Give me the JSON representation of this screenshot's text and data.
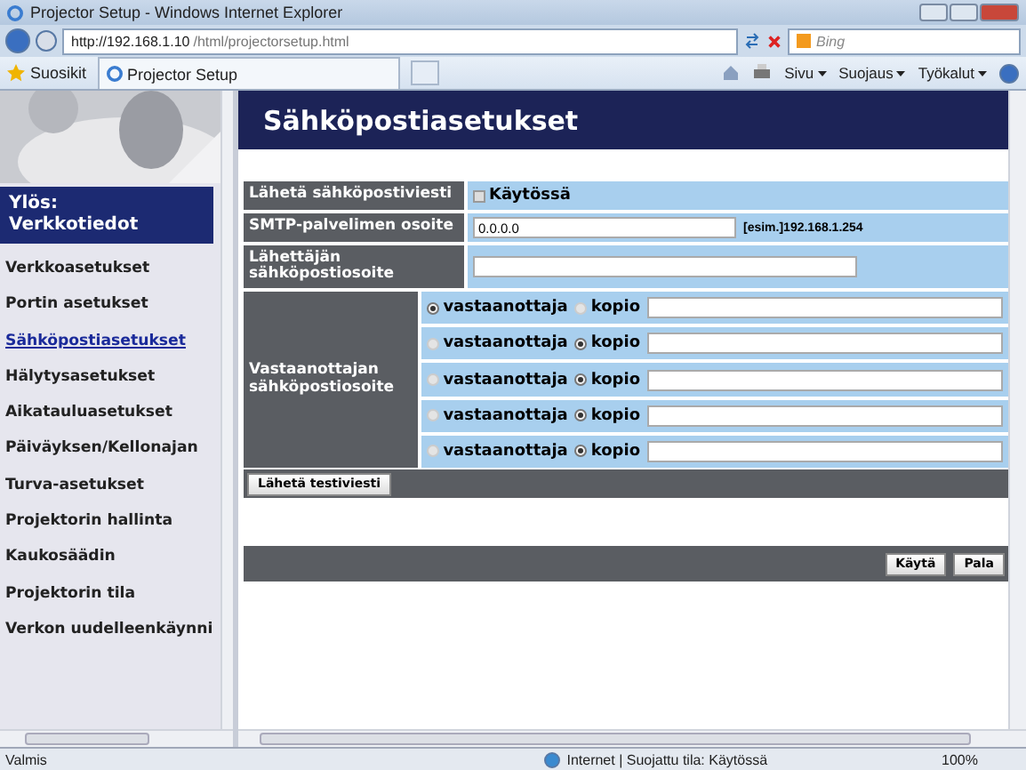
{
  "window": {
    "title": "Projector Setup - Windows Internet Explorer"
  },
  "address_bar": {
    "url_host": "http://192.168.1.10",
    "url_path": "/html/projectorsetup.html",
    "search_placeholder": "Bing"
  },
  "command_bar": {
    "favorites": "Suosikit",
    "tab": "Projector Setup",
    "menus": [
      "Sivu",
      "Suojaus",
      "Työkalut"
    ]
  },
  "sidebar": {
    "header": "Ylös: Verkkotiedot",
    "items": [
      {
        "label": "Verkkoasetukset",
        "selected": false
      },
      {
        "label": "Portin asetukset",
        "selected": false
      },
      {
        "label": "Sähköpostiasetukset",
        "selected": true
      },
      {
        "label": "Hälytysasetukset",
        "selected": false
      },
      {
        "label": "Aikatauluasetukset",
        "selected": false
      },
      {
        "label": "Päiväyksen/Kellonajan",
        "selected": false
      },
      {
        "label": "Turva-asetukset",
        "selected": false
      },
      {
        "label": "Projektorin hallinta",
        "selected": false
      },
      {
        "label": "Kaukosäädin",
        "selected": false
      },
      {
        "label": "Projektorin tila",
        "selected": false
      },
      {
        "label": "Verkon uudelleenkäynni",
        "selected": false
      }
    ]
  },
  "page": {
    "title": "Sähköpostiasetukset",
    "send_mail": {
      "label": "Lähetä sähköpostiviesti",
      "checkbox_label": "Käytössä",
      "checked": false
    },
    "smtp": {
      "label": "SMTP-palvelimen osoite",
      "value": "0.0.0.0",
      "hint": "[esim.]192.168.1.254"
    },
    "sender": {
      "label": "Lähettäjän sähköpostiosoite"
    },
    "recipients": {
      "label": "Vastaanottajan sähköpostiosoite",
      "rows": [
        {
          "options": [
            {
              "label": "vastaanottaja",
              "selected": true
            },
            {
              "label": "kopio",
              "selected": false
            }
          ]
        },
        {
          "options": [
            {
              "label": "vastaanottaja",
              "selected": false
            },
            {
              "label": "kopio",
              "selected": true
            }
          ]
        },
        {
          "options": [
            {
              "label": "vastaanottaja",
              "selected": false
            },
            {
              "label": "kopio",
              "selected": true
            }
          ]
        },
        {
          "options": [
            {
              "label": "vastaanottaja",
              "selected": false
            },
            {
              "label": "kopio",
              "selected": true
            }
          ]
        },
        {
          "options": [
            {
              "label": "vastaanottaja",
              "selected": false
            },
            {
              "label": "kopio",
              "selected": true
            }
          ]
        }
      ]
    },
    "test_button": "Lähetä testiviesti",
    "buttons": [
      "Käytä",
      "Pala"
    ]
  },
  "status_bar": {
    "text": "Valmis",
    "zone": "Internet | Suojattu tila: Käytössä",
    "zoom": "100%"
  }
}
